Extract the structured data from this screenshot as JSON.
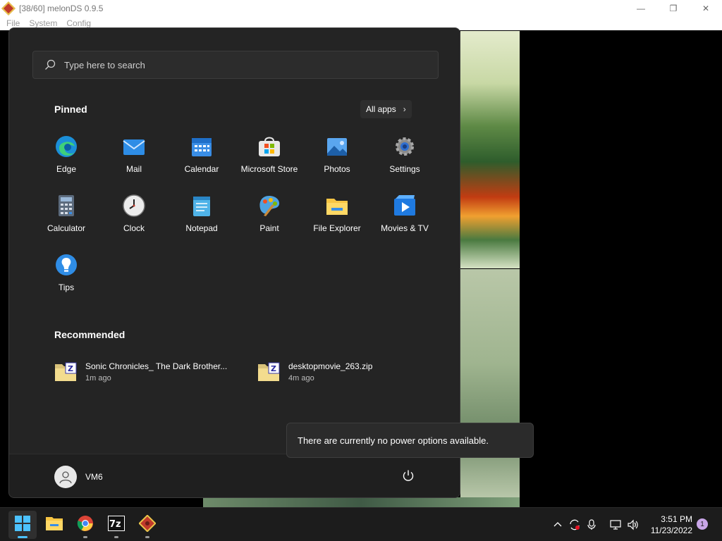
{
  "window": {
    "title": "[38/60] melonDS 0.9.5",
    "minimize_glyph": "—",
    "maximize_glyph": "❐",
    "close_glyph": "✕",
    "menu": [
      "File",
      "System",
      "Config"
    ]
  },
  "start_menu": {
    "search_placeholder": "Type here to search",
    "pinned_title": "Pinned",
    "all_apps_label": "All apps",
    "pinned": [
      {
        "label": "Edge",
        "icon": "edge-icon"
      },
      {
        "label": "Mail",
        "icon": "mail-icon"
      },
      {
        "label": "Calendar",
        "icon": "calendar-icon"
      },
      {
        "label": "Microsoft Store",
        "icon": "microsoft-store-icon"
      },
      {
        "label": "Photos",
        "icon": "photos-icon"
      },
      {
        "label": "Settings",
        "icon": "settings-icon"
      },
      {
        "label": "Calculator",
        "icon": "calculator-icon"
      },
      {
        "label": "Clock",
        "icon": "clock-icon"
      },
      {
        "label": "Notepad",
        "icon": "notepad-icon"
      },
      {
        "label": "Paint",
        "icon": "paint-icon"
      },
      {
        "label": "File Explorer",
        "icon": "file-explorer-icon"
      },
      {
        "label": "Movies & TV",
        "icon": "movies-tv-icon"
      },
      {
        "label": "Tips",
        "icon": "tips-icon"
      }
    ],
    "recommended_title": "Recommended",
    "recommended": [
      {
        "name": "Sonic Chronicles_ The Dark Brother...",
        "time": "1m ago",
        "icon": "zip-folder-icon"
      },
      {
        "name": "desktopmovie_263.zip",
        "time": "4m ago",
        "icon": "zip-folder-icon"
      }
    ],
    "user_name": "VM6",
    "power_tooltip": "There are currently no power options available."
  },
  "taskbar": {
    "apps": [
      {
        "name": "start",
        "icon": "windows-start-icon",
        "active": true
      },
      {
        "name": "file-explorer",
        "icon": "folder-icon",
        "active": false
      },
      {
        "name": "chrome",
        "icon": "chrome-icon",
        "active": false
      },
      {
        "name": "7zip",
        "icon": "7zip-icon",
        "active": false
      },
      {
        "name": "melonds",
        "icon": "melonds-icon",
        "active": false
      }
    ],
    "time": "3:51 PM",
    "date": "11/23/2022",
    "notification_count": "1"
  },
  "colors": {
    "start_bg": "#242424",
    "taskbar_bg": "#1c1c1c",
    "accent": "#4cc2ff"
  }
}
